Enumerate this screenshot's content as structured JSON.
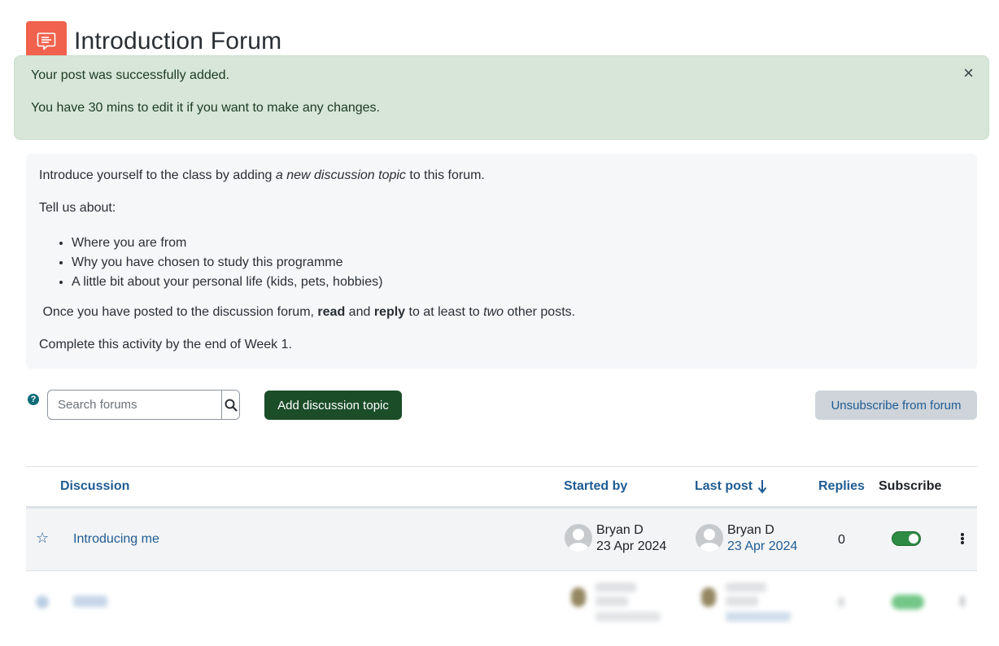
{
  "header": {
    "title": "Introduction Forum",
    "icon": "forum-icon"
  },
  "alert": {
    "line1": "Your post was successfully added.",
    "line2": "You have 30 mins to edit it if you want to make any changes.",
    "close_label": "×"
  },
  "intro": {
    "p1_before": "Introduce yourself to the class by adding ",
    "p1_em": "a new discussion topic",
    "p1_after": " to this forum.",
    "p2": "Tell us about:",
    "bullets": [
      "Where you are from",
      "Why you have chosen to study this programme",
      "A little bit about your personal life (kids, pets, hobbies)"
    ],
    "p3_a": " Once you have posted to the discussion forum, ",
    "p3_b": "read",
    "p3_c": " and ",
    "p3_d": "reply",
    "p3_e": " to at least to ",
    "p3_f": "two",
    "p3_g": " other posts.",
    "p4": "Complete this activity by the end of Week 1."
  },
  "toolbar": {
    "search_placeholder": "Search forums",
    "add_topic_label": "Add discussion topic",
    "unsubscribe_label": "Unsubscribe from forum"
  },
  "table": {
    "headers": {
      "discussion": "Discussion",
      "started_by": "Started by",
      "last_post": "Last post",
      "replies": "Replies",
      "subscribe": "Subscribe"
    },
    "rows": [
      {
        "discussion": "Introducing me",
        "started_by_name": "Bryan D",
        "started_by_date": "23 Apr 2024",
        "last_post_name": "Bryan D",
        "last_post_date": "23 Apr 2024",
        "replies": "0",
        "subscribed": true
      }
    ]
  },
  "colors": {
    "accent": "#1f5c93",
    "forum_icon": "#f0624d",
    "alert_bg": "#d7e6d9",
    "primary_button": "#1b4d29",
    "toggle_on": "#2e8b44"
  }
}
